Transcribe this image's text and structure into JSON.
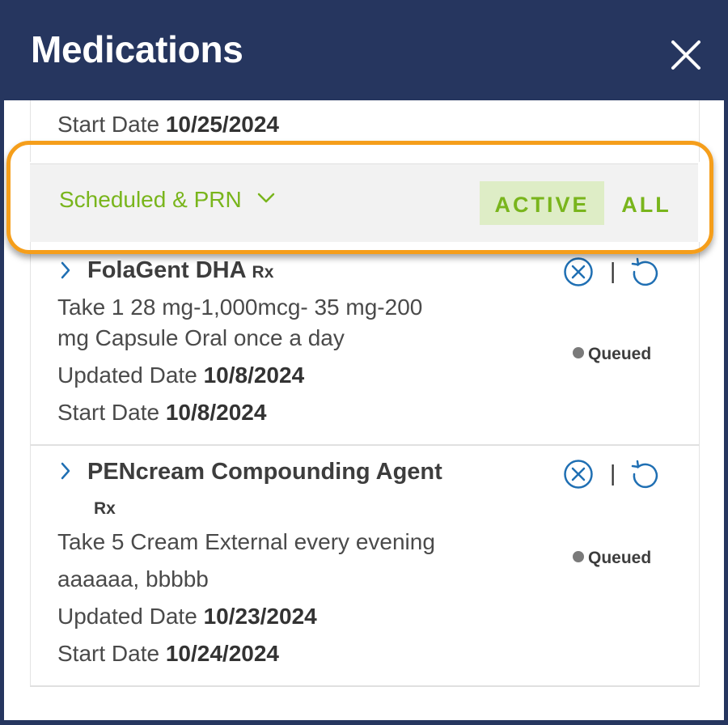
{
  "header": {
    "title": "Medications",
    "close_icon": "close-icon"
  },
  "top_card": {
    "start_label": "Start Date",
    "start_value": "10/25/2024"
  },
  "filter": {
    "selected": "Scheduled & PRN",
    "tabs": [
      {
        "label": "ACTIVE",
        "active": true
      },
      {
        "label": "ALL",
        "active": false
      }
    ]
  },
  "medications": [
    {
      "name": "FolaGent DHA",
      "badge": "Rx",
      "instructions_line1": "Take 1 28 mg-1,000mcg- 35 mg-200",
      "instructions_line2": "mg Capsule Oral once a day",
      "updated_label": "Updated Date",
      "updated_value": "10/8/2024",
      "start_label": "Start Date",
      "start_value": "10/8/2024",
      "status": "Queued",
      "separator": "|"
    },
    {
      "name": "PENcream Compounding Agent",
      "badge": "Rx",
      "instructions_line1": "Take 5 Cream External every evening",
      "instructions_line2": "aaaaaa, bbbbb",
      "updated_label": "Updated Date",
      "updated_value": "10/23/2024",
      "start_label": "Start Date",
      "start_value": "10/24/2024",
      "status": "Queued",
      "separator": "|"
    }
  ],
  "colors": {
    "header_bg": "#26365f",
    "accent_green": "#79b51c",
    "active_tab_bg": "#deedc6",
    "icon_blue": "#1f6fb3",
    "highlight_orange": "#f59e1b"
  }
}
